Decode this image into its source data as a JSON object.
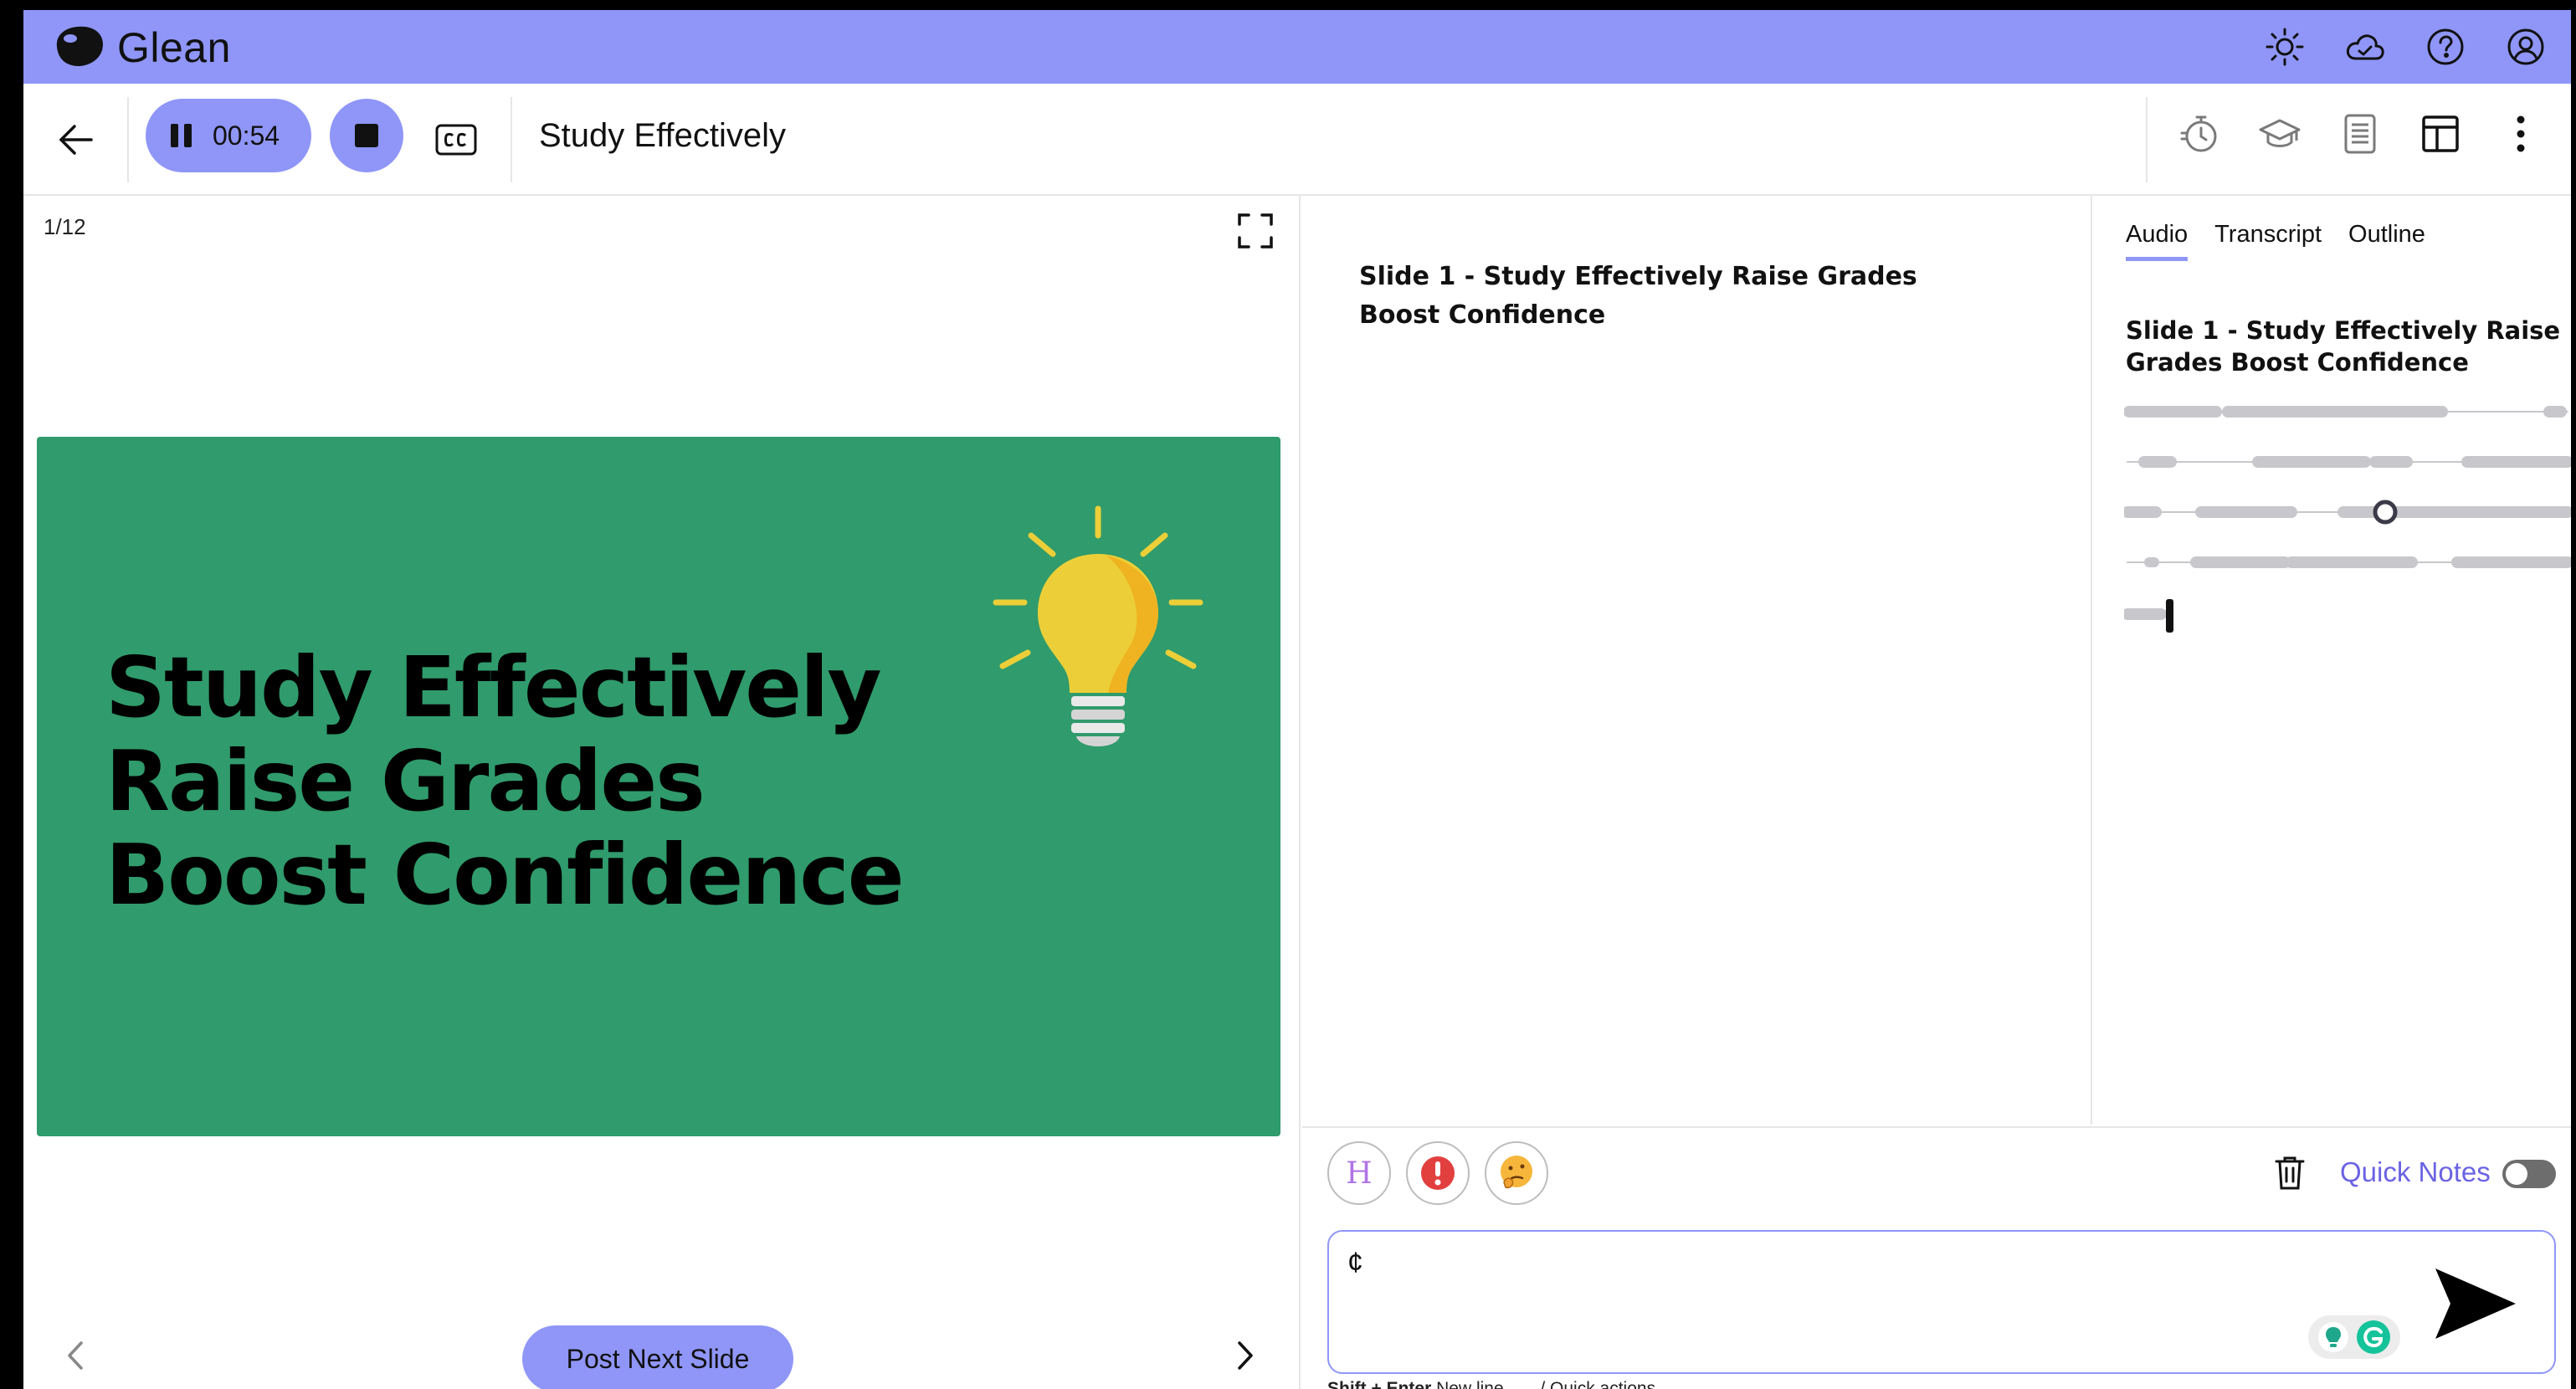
{
  "app": {
    "name": "Glean"
  },
  "brand_icons": [
    "sun-icon",
    "cloud-icon",
    "help-icon",
    "account-icon"
  ],
  "toolbar": {
    "timer": "00:54",
    "title": "Study Effectively",
    "right_icons": [
      "stopwatch-icon",
      "graduation-cap-icon",
      "document-icon",
      "layout-icon",
      "more-icon"
    ]
  },
  "slide": {
    "counter": "1/12",
    "heading_lines": [
      "Study Effectively",
      "Raise Grades",
      "Boost Confidence"
    ],
    "background": "#309b6c",
    "post_button": "Post Next Slide"
  },
  "notes": {
    "title": "Slide 1 - Study Effectively Raise Grades Boost Confidence"
  },
  "audio_panel": {
    "tabs": [
      {
        "label": "Audio",
        "active": true
      },
      {
        "label": "Transcript",
        "active": false
      },
      {
        "label": "Outline",
        "active": false
      }
    ],
    "title": "Slide 1 - Study Effectively Raise Grades Boost Confidence"
  },
  "composer": {
    "reactions": [
      "highlight-icon",
      "important-icon",
      "confused-icon"
    ],
    "quick_notes_label": "Quick Notes",
    "quick_notes_enabled": false,
    "input_value": "¢",
    "hint_keys": "Shift + Enter",
    "hint_newline": "New line",
    "hint_actions": "/ Quick actions"
  },
  "colors": {
    "accent": "#8f96f7",
    "link": "#6b63e3",
    "slide_green": "#309b6c",
    "bulb_yellow": "#eccf38"
  }
}
